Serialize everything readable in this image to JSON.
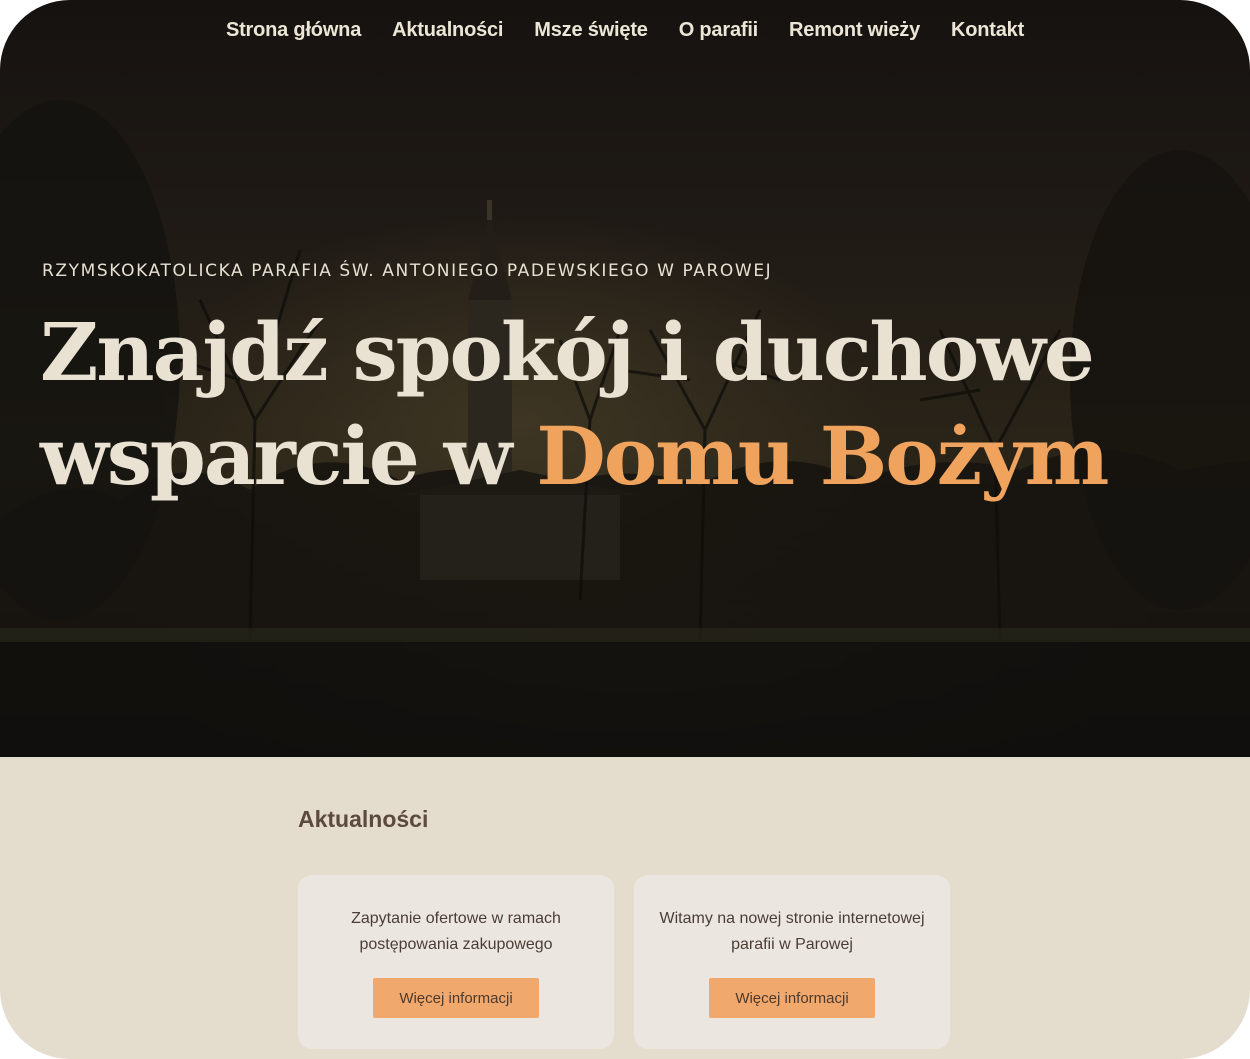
{
  "nav": {
    "items": [
      {
        "label": "Strona główna"
      },
      {
        "label": "Aktualności"
      },
      {
        "label": "Msze święte"
      },
      {
        "label": "O parafii"
      },
      {
        "label": "Remont wieży"
      },
      {
        "label": "Kontakt"
      }
    ]
  },
  "hero": {
    "eyebrow": "RZYMSKOKATOLICKA PARAFIA ŚW. ANTONIEGO PADEWSKIEGO W PAROWEJ",
    "headline_part1": "Znajdź spokój i duchowe wsparcie w ",
    "headline_accent": "Domu Bożym"
  },
  "news": {
    "title": "Aktualności",
    "cards": [
      {
        "text": "Zapytanie ofertowe w ramach postępowania zakupowego",
        "button": "Więcej informacji"
      },
      {
        "text": "Witamy na nowej stronie internetowej parafii w Parowej",
        "button": "Więcej informacji"
      }
    ]
  },
  "colors": {
    "accent": "#f0a35d",
    "button": "#f1a86c",
    "section_bg": "#e4dccc",
    "card_bg": "#ebe7e0"
  }
}
